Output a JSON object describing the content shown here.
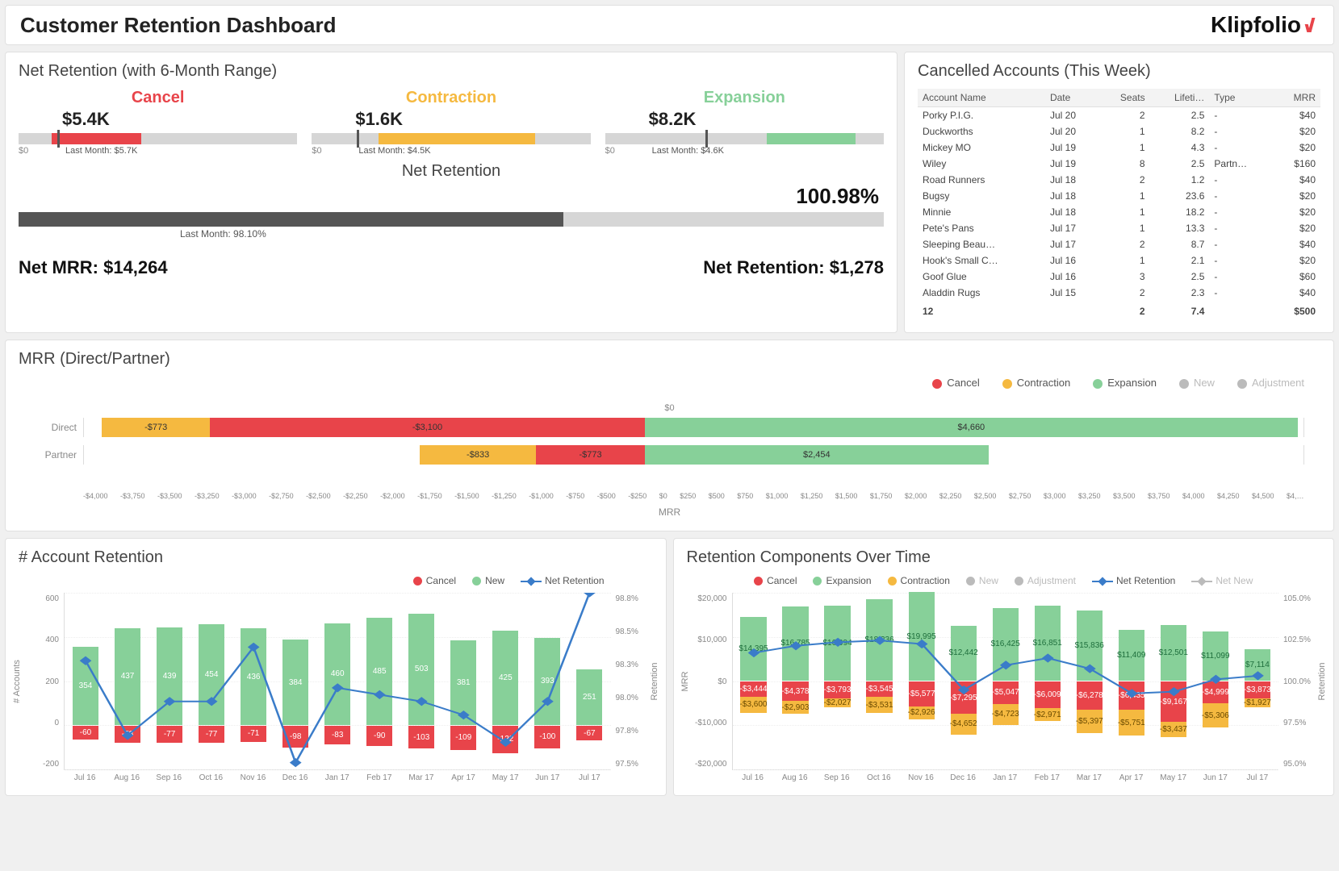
{
  "header": {
    "title": "Customer Retention Dashboard",
    "logo_text": "Klipfolio"
  },
  "net_retention": {
    "title": "Net Retention (with 6-Month Range)",
    "cols": [
      {
        "name": "Cancel",
        "value": "$5.4K",
        "last": "Last Month: $5.7K",
        "color": "var(--red)",
        "fill_pct": 32,
        "fill_left": 12,
        "marker": 14
      },
      {
        "name": "Contraction",
        "value": "$1.6K",
        "last": "Last Month: $4.5K",
        "color": "var(--orange)",
        "fill_pct": 56,
        "fill_left": 24,
        "marker": 16
      },
      {
        "name": "Expansion",
        "value": "$8.2K",
        "last": "Last Month: $4.6K",
        "color": "var(--green)",
        "fill_pct": 32,
        "fill_left": 58,
        "marker": 36
      }
    ],
    "big_title": "Net Retention",
    "big_value": "100.98%",
    "big_fill_pct": 63,
    "big_last": "Last Month: 98.10%",
    "net_mrr": "Net MRR: $14,264",
    "net_ret": "Net Retention: $1,278"
  },
  "cancelled": {
    "title": "Cancelled Accounts (This Week)",
    "headers": [
      "Account Name",
      "Date",
      "Seats",
      "Lifeti…",
      "Type",
      "MRR"
    ],
    "rows": [
      {
        "name": "Porky P.I.G.",
        "date": "Jul 20",
        "seats": "2",
        "life": "2.5",
        "life_red": true,
        "type": "-",
        "mrr": "$40"
      },
      {
        "name": "Duckworths",
        "date": "Jul 20",
        "seats": "1",
        "life": "8.2",
        "type": "-",
        "mrr": "$20"
      },
      {
        "name": "Mickey MO",
        "date": "Jul 19",
        "seats": "1",
        "life": "4.3",
        "life_red": true,
        "type": "-",
        "mrr": "$20"
      },
      {
        "name": "Wiley",
        "date": "Jul 19",
        "seats": "8",
        "life": "2.5",
        "life_red": true,
        "type": "Partn…",
        "mrr": "$160",
        "mrr_red": true
      },
      {
        "name": "Road Runners",
        "date": "Jul 18",
        "seats": "2",
        "life": "1.2",
        "life_red": true,
        "type": "-",
        "mrr": "$40"
      },
      {
        "name": "Bugsy",
        "date": "Jul 18",
        "seats": "1",
        "life": "23.6",
        "type": "-",
        "mrr": "$20"
      },
      {
        "name": "Minnie",
        "date": "Jul 18",
        "seats": "1",
        "life": "18.2",
        "type": "-",
        "mrr": "$20"
      },
      {
        "name": "Pete's Pans",
        "date": "Jul 17",
        "seats": "1",
        "life": "13.3",
        "type": "-",
        "mrr": "$20"
      },
      {
        "name": "Sleeping Beau…",
        "date": "Jul 17",
        "seats": "2",
        "life": "8.7",
        "type": "-",
        "mrr": "$40"
      },
      {
        "name": "Hook's Small C…",
        "date": "Jul 16",
        "seats": "1",
        "life": "2.1",
        "life_red": true,
        "type": "-",
        "mrr": "$20"
      },
      {
        "name": "Goof Glue",
        "date": "Jul 16",
        "seats": "3",
        "life": "2.5",
        "life_red": true,
        "type": "-",
        "mrr": "$60"
      },
      {
        "name": "Aladdin Rugs",
        "date": "Jul 15",
        "seats": "2",
        "life": "2.3",
        "life_red": true,
        "type": "-",
        "mrr": "$40"
      }
    ],
    "footer": {
      "count": "12",
      "seats": "2",
      "life": "7.4",
      "mrr": "$500"
    }
  },
  "mrr_bar": {
    "title": "MRR (Direct/Partner)",
    "legend": [
      "Cancel",
      "Contraction",
      "Expansion",
      "New",
      "Adjustment"
    ],
    "zero_label": "$0",
    "x_label": "MRR",
    "x_ticks": [
      "-$4,000",
      "-$3,750",
      "-$3,500",
      "-$3,250",
      "-$3,000",
      "-$2,750",
      "-$2,500",
      "-$2,250",
      "-$2,000",
      "-$1,750",
      "-$1,500",
      "-$1,250",
      "-$1,000",
      "-$750",
      "-$500",
      "-$250",
      "$0",
      "$250",
      "$500",
      "$750",
      "$1,000",
      "$1,250",
      "$1,500",
      "$1,750",
      "$2,000",
      "$2,250",
      "$2,500",
      "$2,750",
      "$3,000",
      "$3,250",
      "$3,500",
      "$3,750",
      "$4,000",
      "$4,250",
      "$4,500",
      "$4,…"
    ],
    "rows": [
      {
        "label": "Direct",
        "segs": [
          {
            "color": "var(--orange)",
            "from": -3873,
            "to": -3100,
            "label": "-$773"
          },
          {
            "color": "var(--red)",
            "from": -3100,
            "to": 0,
            "label": "-$3,100"
          },
          {
            "color": "var(--green)",
            "from": 0,
            "to": 4660,
            "label": "$4,660"
          }
        ]
      },
      {
        "label": "Partner",
        "segs": [
          {
            "color": "var(--orange)",
            "from": -1606,
            "to": -773,
            "label": "-$833"
          },
          {
            "color": "var(--red)",
            "from": -773,
            "to": 0,
            "label": "-$773"
          },
          {
            "color": "var(--green)",
            "from": 0,
            "to": 2454,
            "label": "$2,454"
          }
        ]
      }
    ],
    "range": [
      -4000,
      4700
    ]
  },
  "account_ret": {
    "title": "# Account Retention",
    "legend": [
      "Cancel",
      "New",
      "Net Retention"
    ],
    "yl_label": "# Accounts",
    "yr_label": "Retention",
    "yl": [
      600,
      400,
      200,
      0,
      -200
    ],
    "yr": [
      "98.8%",
      "98.5%",
      "98.3%",
      "98.0%",
      "97.8%",
      "97.5%"
    ],
    "x": [
      "Jul 16",
      "Aug 16",
      "Sep 16",
      "Oct 16",
      "Nov 16",
      "Dec 16",
      "Jan 17",
      "Feb 17",
      "Mar 17",
      "Apr 17",
      "May 17",
      "Jun 17",
      "Jul 17"
    ],
    "new": [
      354,
      437,
      439,
      454,
      436,
      384,
      460,
      485,
      503,
      381,
      425,
      393,
      251
    ],
    "cancel": [
      -60,
      -78,
      -77,
      -77,
      -71,
      -98,
      -83,
      -90,
      -103,
      -109,
      -122,
      -100,
      -67
    ],
    "line": [
      98.3,
      97.75,
      98.0,
      98.0,
      98.4,
      97.55,
      98.1,
      98.05,
      98.0,
      97.9,
      97.7,
      98.0,
      98.8
    ]
  },
  "ret_comp": {
    "title": "Retention Components Over Time",
    "legend": [
      "Cancel",
      "Expansion",
      "Contraction",
      "New",
      "Adjustment",
      "Net Retention",
      "Net New"
    ],
    "yl_label": "MRR",
    "yr_label": "Retention",
    "yl": [
      "$20,000",
      "$10,000",
      "$0",
      "-$10,000",
      "-$20,000"
    ],
    "yr": [
      "105.0%",
      "102.5%",
      "100.0%",
      "97.5%",
      "95.0%"
    ],
    "x": [
      "Jul 16",
      "Aug 16",
      "Sep 16",
      "Oct 16",
      "Nov 16",
      "Dec 16",
      "Jan 17",
      "Feb 17",
      "Mar 17",
      "Apr 17",
      "May 17",
      "Jun 17",
      "Jul 17"
    ],
    "expansion": [
      14395,
      16785,
      16994,
      18336,
      19995,
      12442,
      16425,
      16851,
      15836,
      11409,
      12501,
      11099,
      7114
    ],
    "cancel": [
      -3444,
      -4378,
      -3793,
      -3545,
      -5577,
      -7295,
      -5047,
      -6009,
      -6278,
      -6435,
      -9167,
      -4999,
      -3873
    ],
    "contraction": [
      -3600,
      -2903,
      -2027,
      -3531,
      -2926,
      -4652,
      -4723,
      -2971,
      -5397,
      -5751,
      -3437,
      -5306,
      -1927
    ],
    "line": [
      101.6,
      102.0,
      102.2,
      102.3,
      102.1,
      99.5,
      100.9,
      101.3,
      100.7,
      99.3,
      99.4,
      100.1,
      100.3
    ]
  },
  "chart_data": [
    {
      "type": "bar",
      "title": "Net Retention bullet — Cancel",
      "value": 5400,
      "last_month": 5700,
      "unit": "$"
    },
    {
      "type": "bar",
      "title": "Net Retention bullet — Contraction",
      "value": 1600,
      "last_month": 4500,
      "unit": "$"
    },
    {
      "type": "bar",
      "title": "Net Retention bullet — Expansion",
      "value": 8200,
      "last_month": 4600,
      "unit": "$"
    },
    {
      "type": "bar",
      "title": "Net Retention",
      "value": 100.98,
      "last_month": 98.1,
      "unit": "%"
    },
    {
      "type": "bar",
      "title": "MRR (Direct/Partner)",
      "orientation": "horizontal",
      "xlabel": "MRR",
      "xlim": [
        -4000,
        4700
      ],
      "categories": [
        "Direct",
        "Partner"
      ],
      "series": [
        {
          "name": "Contraction",
          "values": [
            -773,
            -833
          ]
        },
        {
          "name": "Cancel",
          "values": [
            -3100,
            -773
          ]
        },
        {
          "name": "Expansion",
          "values": [
            4660,
            2454
          ]
        }
      ]
    },
    {
      "type": "bar",
      "title": "# Account Retention",
      "xlabel": "",
      "ylabel": "# Accounts",
      "y2label": "Retention",
      "categories": [
        "Jul 16",
        "Aug 16",
        "Sep 16",
        "Oct 16",
        "Nov 16",
        "Dec 16",
        "Jan 17",
        "Feb 17",
        "Mar 17",
        "Apr 17",
        "May 17",
        "Jun 17",
        "Jul 17"
      ],
      "series": [
        {
          "name": "New",
          "values": [
            354,
            437,
            439,
            454,
            436,
            384,
            460,
            485,
            503,
            381,
            425,
            393,
            251
          ]
        },
        {
          "name": "Cancel",
          "values": [
            -60,
            -78,
            -77,
            -77,
            -71,
            -98,
            -83,
            -90,
            -103,
            -109,
            -122,
            -100,
            -67
          ]
        },
        {
          "name": "Net Retention",
          "axis": "y2",
          "type": "line",
          "values": [
            98.3,
            97.75,
            98.0,
            98.0,
            98.4,
            97.55,
            98.1,
            98.05,
            98.0,
            97.9,
            97.7,
            98.0,
            98.8
          ]
        }
      ],
      "ylim": [
        -200,
        600
      ],
      "y2lim": [
        97.5,
        98.8
      ]
    },
    {
      "type": "bar",
      "title": "Retention Components Over Time",
      "xlabel": "",
      "ylabel": "MRR",
      "y2label": "Retention",
      "categories": [
        "Jul 16",
        "Aug 16",
        "Sep 16",
        "Oct 16",
        "Nov 16",
        "Dec 16",
        "Jan 17",
        "Feb 17",
        "Mar 17",
        "Apr 17",
        "May 17",
        "Jun 17",
        "Jul 17"
      ],
      "series": [
        {
          "name": "Expansion",
          "values": [
            14395,
            16785,
            16994,
            18336,
            19995,
            12442,
            16425,
            16851,
            15836,
            11409,
            12501,
            11099,
            7114
          ]
        },
        {
          "name": "Cancel",
          "values": [
            -3444,
            -4378,
            -3793,
            -3545,
            -5577,
            -7295,
            -5047,
            -6009,
            -6278,
            -6435,
            -9167,
            -4999,
            -3873
          ]
        },
        {
          "name": "Contraction",
          "values": [
            -3600,
            -2903,
            -2027,
            -3531,
            -2926,
            -4652,
            -4723,
            -2971,
            -5397,
            -5751,
            -3437,
            -5306,
            -1927
          ]
        },
        {
          "name": "Net Retention",
          "axis": "y2",
          "type": "line",
          "values": [
            101.6,
            102.0,
            102.2,
            102.3,
            102.1,
            99.5,
            100.9,
            101.3,
            100.7,
            99.3,
            99.4,
            100.1,
            100.3
          ]
        }
      ],
      "ylim": [
        -20000,
        20000
      ],
      "y2lim": [
        95.0,
        105.0
      ]
    }
  ]
}
